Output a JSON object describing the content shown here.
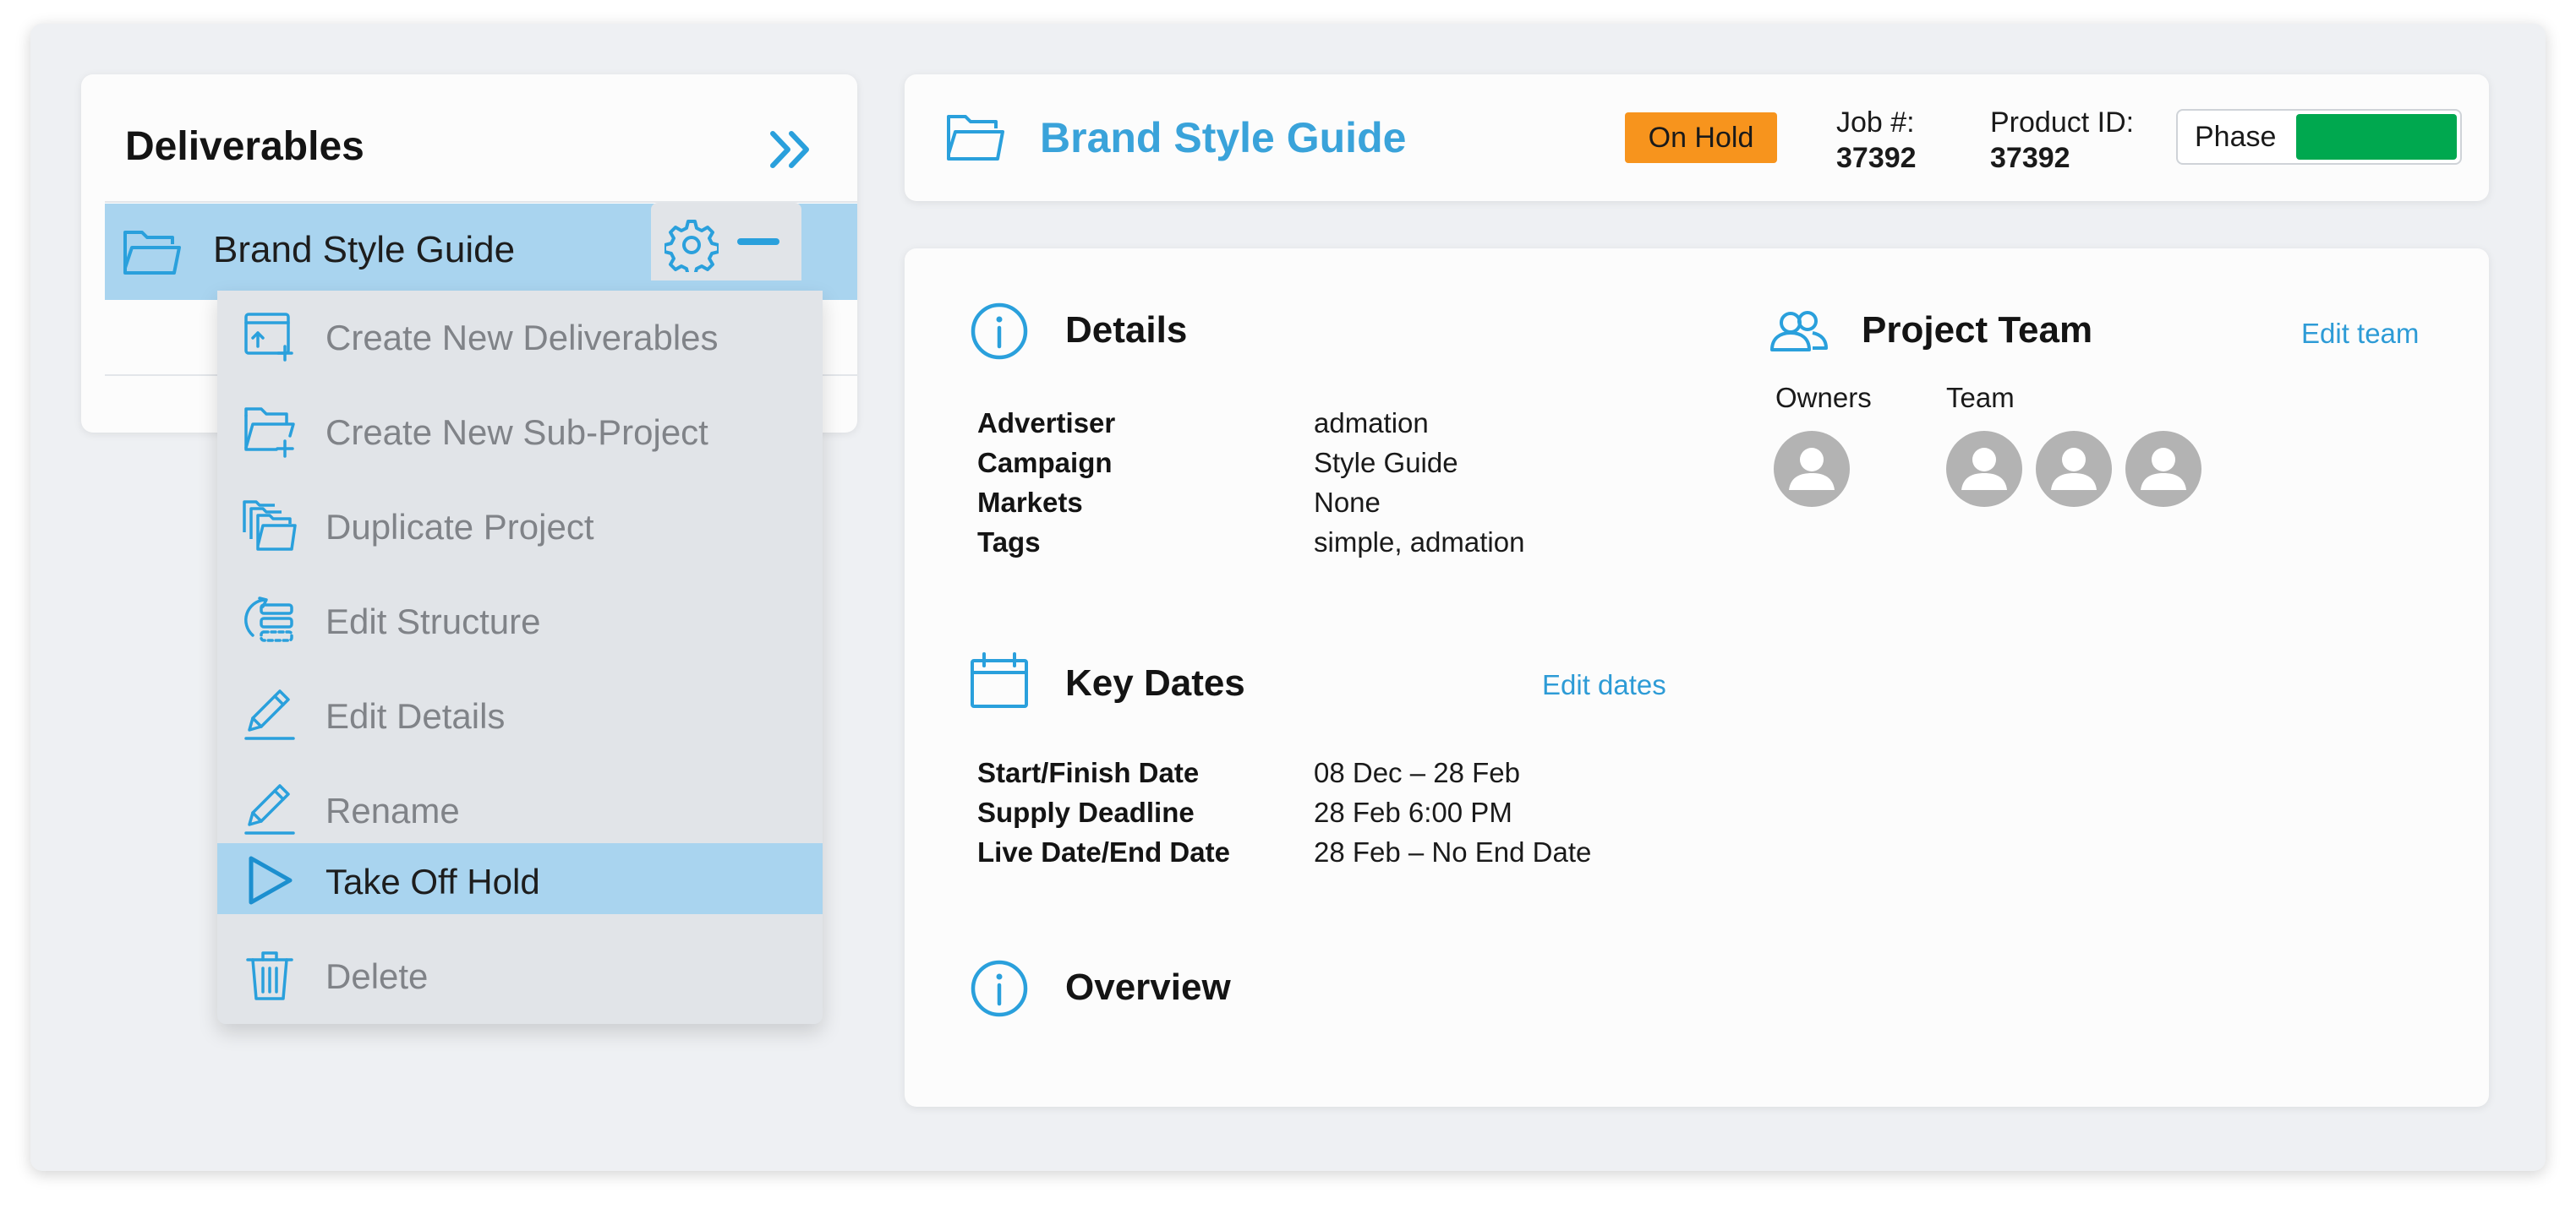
{
  "colors": {
    "accent": "#2aa0dc",
    "selected_row": "#a9d4ef",
    "status_on_hold": "#f7941d",
    "phase_fill": "#00a84f"
  },
  "sidebar": {
    "title": "Deliverables",
    "expand_icon": "double-chevron-right-icon",
    "tree": [
      {
        "label": "Brand Style Guide",
        "icon": "folder-icon",
        "selected": true
      }
    ],
    "row_actions": {
      "settings_icon": "gear-icon",
      "collapse_icon": "minus-icon"
    }
  },
  "context_menu": {
    "items": [
      {
        "label": "Create New Deliverables",
        "icon": "create-deliverable-icon",
        "active": false
      },
      {
        "label": "Create New Sub-Project",
        "icon": "create-subproject-icon",
        "active": false
      },
      {
        "label": "Duplicate Project",
        "icon": "duplicate-icon",
        "active": false
      },
      {
        "label": "Edit Structure",
        "icon": "edit-structure-icon",
        "active": false
      },
      {
        "label": "Edit Details",
        "icon": "pencil-icon",
        "active": false
      },
      {
        "label": "Rename",
        "icon": "pencil-icon",
        "active": false
      },
      {
        "label": "Take Off Hold",
        "icon": "play-icon",
        "active": true
      },
      {
        "label": "Delete",
        "icon": "trash-icon",
        "active": false
      }
    ]
  },
  "header": {
    "title": "Brand Style Guide",
    "status": "On Hold",
    "job_label": "Job #:",
    "job_value": "37392",
    "product_label": "Product ID:",
    "product_value": "37392",
    "phase_label": "Phase",
    "phase_progress": 1.0
  },
  "details": {
    "title": "Details",
    "fields": [
      {
        "key": "Advertiser",
        "value": "admation"
      },
      {
        "key": "Campaign",
        "value": "Style Guide"
      },
      {
        "key": "Markets",
        "value": "None"
      },
      {
        "key": "Tags",
        "value": "simple, admation"
      }
    ]
  },
  "team": {
    "title": "Project Team",
    "edit_label": "Edit team",
    "owners_label": "Owners",
    "team_label": "Team",
    "owner_count": 1,
    "member_count": 3
  },
  "key_dates": {
    "title": "Key Dates",
    "edit_label": "Edit dates",
    "fields": [
      {
        "key": "Start/Finish Date",
        "value": "08 Dec – 28 Feb"
      },
      {
        "key": "Supply Deadline",
        "value": "28 Feb 6:00 PM"
      },
      {
        "key": "Live Date/End Date",
        "value": "28 Feb – No End Date"
      }
    ]
  },
  "overview": {
    "title": "Overview"
  }
}
